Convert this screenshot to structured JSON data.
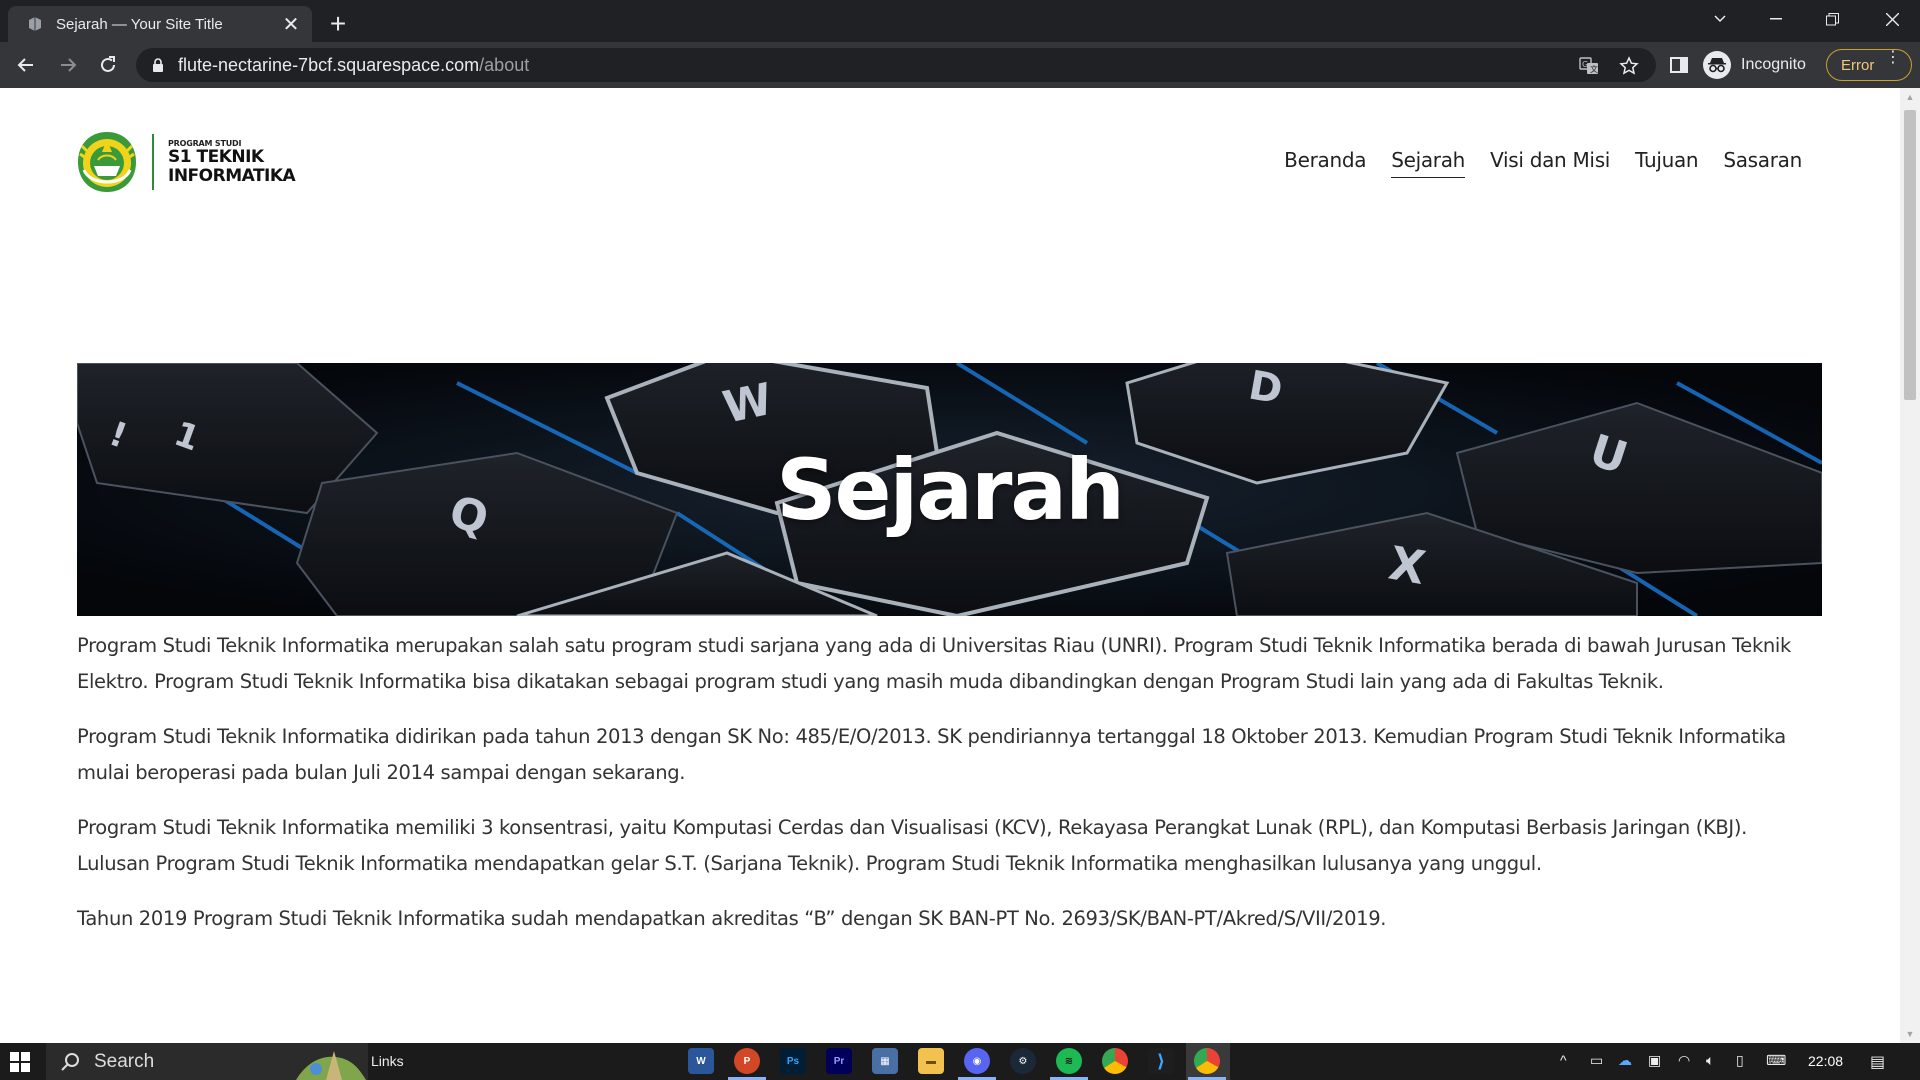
{
  "browser": {
    "tab_title": "Sejarah — Your Site Title",
    "url_host": "flute-nectarine-7bcf.squarespace.com",
    "url_path": "/about",
    "profile_label": "Incognito",
    "error_label": "Error"
  },
  "site": {
    "logo_small": "PROGRAM STUDI",
    "logo_line1": "S1 TEKNIK",
    "logo_line2": "INFORMATIKA",
    "nav": [
      "Beranda",
      "Sejarah",
      "Visi dan Misi",
      "Tujuan",
      "Sasaran"
    ],
    "active_nav": "Sejarah",
    "hero_title": "Sejarah",
    "paragraphs": [
      "Program Studi Teknik Informatika merupakan salah satu program studi sarjana yang ada di Universitas Riau (UNRI). Program Studi Teknik Informatika berada di bawah Jurusan Teknik Elektro. Program Studi Teknik Informatika bisa dikatakan sebagai program studi yang masih muda dibandingkan dengan Program Studi lain yang ada di Fakultas Teknik.",
      "Program Studi Teknik Informatika didirikan pada tahun 2013 dengan SK No: 485/E/O/2013. SK pendiriannya tertanggal 18 Oktober 2013. Kemudian Program Studi Teknik Informatika mulai beroperasi pada bulan Juli 2014 sampai dengan sekarang.",
      "Program Studi Teknik Informatika memiliki 3 konsentrasi, yaitu Komputasi Cerdas dan Visualisasi (KCV), Rekayasa Perangkat Lunak (RPL), dan Komputasi Berbasis Jaringan (KBJ). Lulusan Program Studi Teknik Informatika mendapatkan gelar S.T. (Sarjana Teknik). Program Studi Teknik Informatika menghasilkan lulusanya yang unggul.",
      "Tahun 2019 Program Studi Teknik Informatika sudah mendapatkan akreditas “B” dengan SK BAN-PT No. 2693/SK/BAN-PT/Akred/S/VII/2019."
    ]
  },
  "taskbar": {
    "search_placeholder": "Search",
    "links_label": "Links",
    "clock": "22:08"
  }
}
